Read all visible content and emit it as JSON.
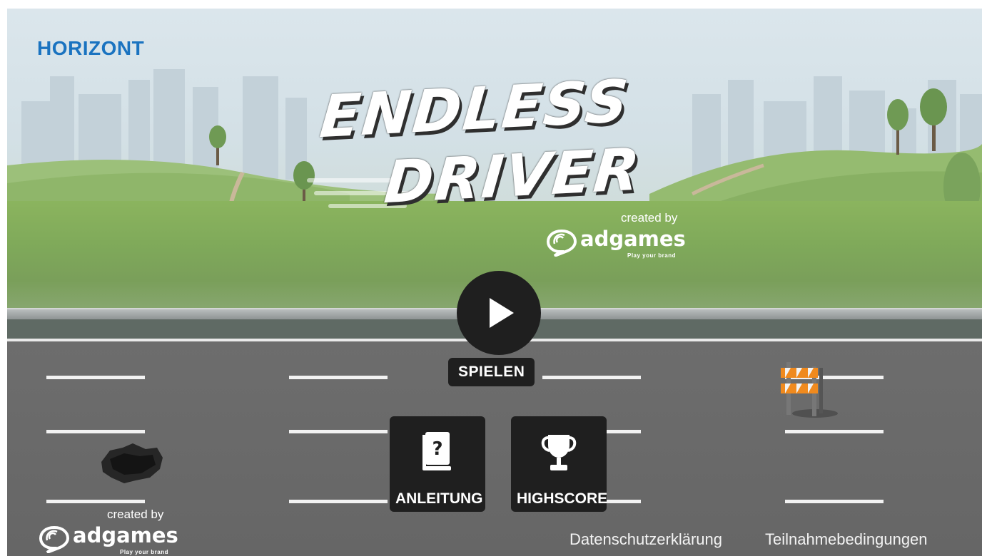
{
  "brand": {
    "name": "HORIZONT",
    "color": "#1a73c0"
  },
  "game": {
    "title_line1": "ENDLESS",
    "title_line2": "DRIVER",
    "credit_label": "created by",
    "credit_company": "adgames",
    "credit_tagline": "Play your brand"
  },
  "menu": {
    "play": {
      "label": "SPIELEN",
      "icon": "play-icon"
    },
    "instructions": {
      "label": "ANLEITUNG",
      "icon": "help-book-icon"
    },
    "highscore": {
      "label": "HIGHSCORE",
      "icon": "trophy-icon"
    }
  },
  "footer": {
    "credit_label": "created by",
    "credit_company": "adgames",
    "credit_tagline": "Play your brand",
    "privacy_link": "Datenschutzerklärung",
    "terms_link": "Teilnahmebedingungen"
  },
  "scene": {
    "obstacles": [
      "pothole",
      "road-barrier"
    ],
    "colors": {
      "road": "#686868",
      "grass": "#82ad5b",
      "sky": "#d8e4ea",
      "button": "#1f1f1f"
    }
  }
}
